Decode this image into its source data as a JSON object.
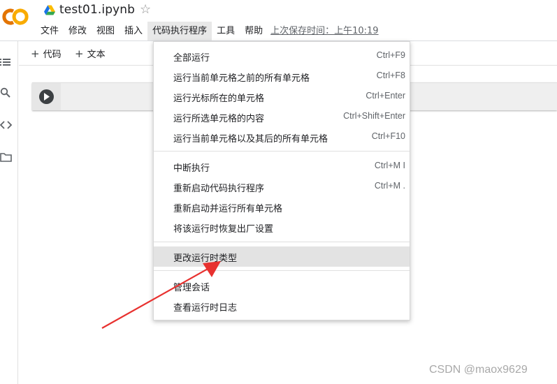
{
  "header": {
    "title": "test01.ipynb",
    "last_saved": "上次保存时间：上午10:19"
  },
  "menubar": {
    "items": [
      "文件",
      "修改",
      "视图",
      "插入",
      "代码执行程序",
      "工具",
      "帮助"
    ]
  },
  "toolbar": {
    "add_code": "代码",
    "add_text": "文本"
  },
  "runtime_menu": {
    "items": [
      {
        "label": "全部运行",
        "shortcut": "Ctrl+F9"
      },
      {
        "label": "运行当前单元格之前的所有单元格",
        "shortcut": "Ctrl+F8"
      },
      {
        "label": "运行光标所在的单元格",
        "shortcut": "Ctrl+Enter"
      },
      {
        "label": "运行所选单元格的内容",
        "shortcut": "Ctrl+Shift+Enter"
      },
      {
        "label": "运行当前单元格以及其后的所有单元格",
        "shortcut": "Ctrl+F10"
      },
      {
        "label": "中断执行",
        "shortcut": "Ctrl+M I"
      },
      {
        "label": "重新启动代码执行程序",
        "shortcut": "Ctrl+M ."
      },
      {
        "label": "重新启动并运行所有单元格",
        "shortcut": ""
      },
      {
        "label": "将该运行时恢复出厂设置",
        "shortcut": ""
      },
      {
        "label": "更改运行时类型",
        "shortcut": ""
      },
      {
        "label": "管理会话",
        "shortcut": ""
      },
      {
        "label": "查看运行时日志",
        "shortcut": ""
      }
    ],
    "highlighted": "更改运行时类型"
  },
  "watermark": "CSDN @maox9629",
  "colors": {
    "logo_orange": "#f9ab00",
    "logo_dark_orange": "#e37400",
    "highlight_bg": "#e3e3e3",
    "annotation_arrow": "#e8312f"
  }
}
